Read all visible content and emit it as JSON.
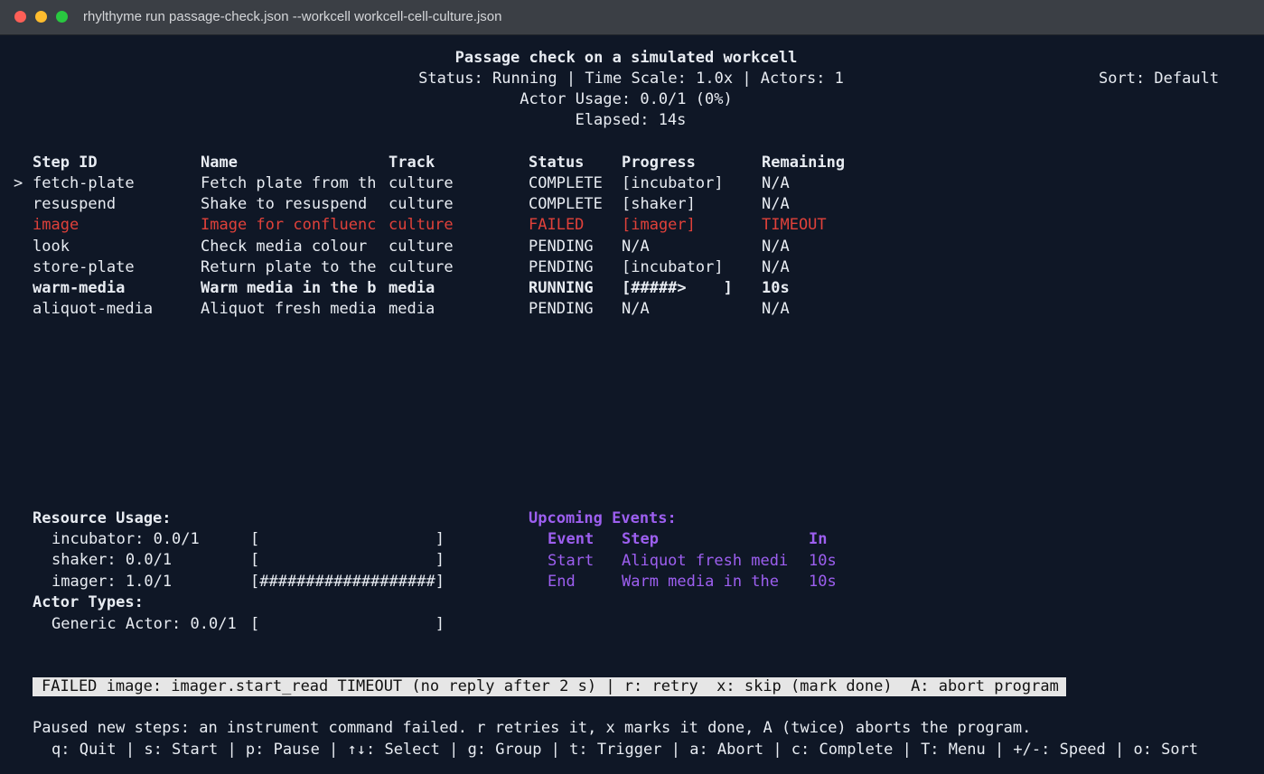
{
  "window": {
    "title": "rhylthyme run passage-check.json --workcell workcell-cell-culture.json",
    "controls": [
      "close",
      "minimize",
      "zoom"
    ]
  },
  "header": {
    "title": "Passage check on a simulated workcell",
    "status_line": "Status: Running | Time Scale: 1.0x | Actors: 1",
    "sort": "Sort: Default",
    "actor_usage": "Actor Usage: 0.0/1 (0%)",
    "elapsed": "Elapsed: 14s"
  },
  "table": {
    "cursor": ">",
    "headers": {
      "id": "Step ID",
      "name": "Name",
      "track": "Track",
      "status": "Status",
      "progress": "Progress",
      "remaining": "Remaining"
    },
    "rows": [
      {
        "id": "fetch-plate",
        "name": "Fetch plate from th",
        "track": "culture",
        "status": "COMPLETE",
        "progress": "[incubator]",
        "remaining": "N/A",
        "style": "normal"
      },
      {
        "id": "resuspend",
        "name": "Shake to resuspend",
        "track": "culture",
        "status": "COMPLETE",
        "progress": "[shaker]",
        "remaining": "N/A",
        "style": "normal"
      },
      {
        "id": "image",
        "name": "Image for confluenc",
        "track": "culture",
        "status": "FAILED",
        "progress": "[imager]",
        "remaining": "TIMEOUT",
        "style": "failed"
      },
      {
        "id": "look",
        "name": "Check media colour",
        "track": "culture",
        "status": "PENDING",
        "progress": "N/A",
        "remaining": "N/A",
        "style": "normal"
      },
      {
        "id": "store-plate",
        "name": "Return plate to the",
        "track": "culture",
        "status": "PENDING",
        "progress": "[incubator]",
        "remaining": "N/A",
        "style": "normal"
      },
      {
        "id": "warm-media",
        "name": "Warm media in the b",
        "track": "media",
        "status": "RUNNING",
        "progress": "[#####>    ]",
        "remaining": "10s",
        "style": "running"
      },
      {
        "id": "aliquot-media",
        "name": "Aliquot fresh media",
        "track": "media",
        "status": "PENDING",
        "progress": "N/A",
        "remaining": "N/A",
        "style": "normal"
      }
    ]
  },
  "resources": {
    "heading": "Resource Usage:",
    "items": [
      {
        "label": "incubator: 0.0/1",
        "bar": "[                   ]"
      },
      {
        "label": "shaker: 0.0/1",
        "bar": "[                   ]"
      },
      {
        "label": "imager: 1.0/1",
        "bar": "[###################]"
      }
    ],
    "actor_heading": "Actor Types:",
    "actors": [
      {
        "label": "Generic Actor: 0.0/1",
        "bar": "[                   ]"
      }
    ]
  },
  "events": {
    "heading": "Upcoming Events:",
    "headers": {
      "event": "Event",
      "step": "Step",
      "in": "In"
    },
    "rows": [
      {
        "event": "Start",
        "step": "Aliquot fresh medi",
        "in": "10s"
      },
      {
        "event": "End",
        "step": "Warm media in the",
        "in": "10s"
      }
    ]
  },
  "statusbar": "FAILED image: imager.start_read TIMEOUT (no reply after 2 s) | r: retry  x: skip (mark done)  A: abort program",
  "footer": {
    "message": "Paused new steps: an instrument command failed. r retries it, x marks it done, A (twice) aborts the program.",
    "keys": "q: Quit | s: Start | p: Pause | ↑↓: Select | g: Group | t: Trigger | a: Abort | c: Complete | T: Menu | +/-: Speed | o: Sort"
  },
  "colors": {
    "background": "#0f1726",
    "failed": "#e0413a",
    "events": "#9d5ff0",
    "statusbar_bg": "#e6e6e6"
  }
}
